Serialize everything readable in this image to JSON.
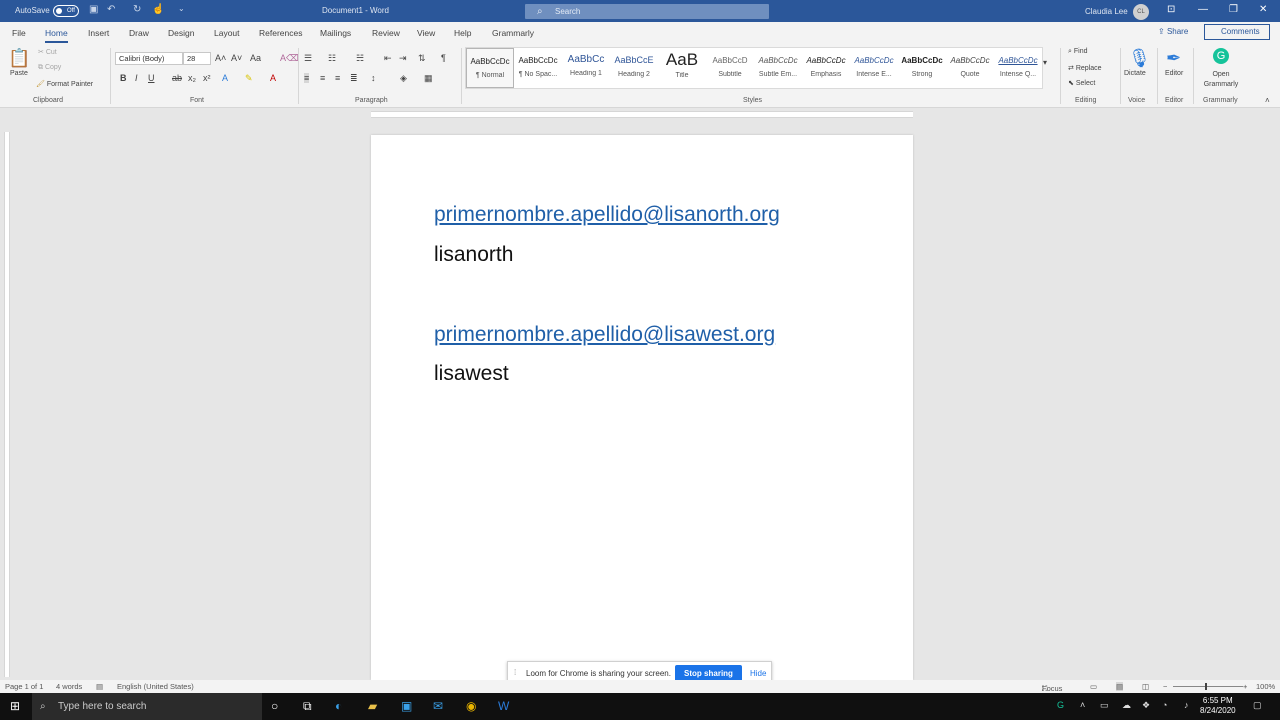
{
  "titlebar": {
    "autosave": "AutoSave",
    "autosave_state": "Off",
    "doc_title": "Document1 - Word",
    "search_placeholder": "Search",
    "user_name": "Claudia Lee",
    "user_initials": "CL"
  },
  "tabs": [
    "File",
    "Home",
    "Insert",
    "Draw",
    "Design",
    "Layout",
    "References",
    "Mailings",
    "Review",
    "View",
    "Help",
    "Grammarly"
  ],
  "share": "Share",
  "comments": "Comments",
  "clipboard": {
    "paste": "Paste",
    "cut": "Cut",
    "copy": "Copy",
    "format_painter": "Format Painter",
    "label": "Clipboard"
  },
  "font": {
    "name": "Calibri (Body)",
    "size": "28",
    "label": "Font"
  },
  "paragraph": {
    "label": "Paragraph"
  },
  "styles": {
    "label": "Styles",
    "items": [
      {
        "preview": "AaBbCcDc",
        "name": "¶ Normal"
      },
      {
        "preview": "AaBbCcDc",
        "name": "¶ No Spac..."
      },
      {
        "preview": "AaBbCc",
        "name": "Heading 1"
      },
      {
        "preview": "AaBbCcE",
        "name": "Heading 2"
      },
      {
        "preview": "AaB",
        "name": "Title"
      },
      {
        "preview": "AaBbCcD",
        "name": "Subtitle"
      },
      {
        "preview": "AaBbCcDc",
        "name": "Subtle Em..."
      },
      {
        "preview": "AaBbCcDc",
        "name": "Emphasis"
      },
      {
        "preview": "AaBbCcDc",
        "name": "Intense E..."
      },
      {
        "preview": "AaBbCcDc",
        "name": "Strong"
      },
      {
        "preview": "AaBbCcDc",
        "name": "Quote"
      },
      {
        "preview": "AaBbCcDc",
        "name": "Intense Q..."
      }
    ]
  },
  "editing": {
    "find": "Find",
    "replace": "Replace",
    "select": "Select",
    "label": "Editing"
  },
  "voice": {
    "dictate": "Dictate",
    "label": "Voice"
  },
  "editor": {
    "editor": "Editor",
    "label": "Editor"
  },
  "grammarly": {
    "open": "Open Grammarly",
    "label": "Grammarly"
  },
  "document": {
    "lines": [
      {
        "text": "primernombre.apellido@lisanorth.org",
        "link": true
      },
      {
        "text": "lisanorth",
        "link": false
      },
      {
        "text": "primernombre.apellido@lisawest.org",
        "link": true
      },
      {
        "text": "lisawest",
        "link": false
      }
    ]
  },
  "loom": {
    "message": "Loom for Chrome is sharing your screen.",
    "stop": "Stop sharing",
    "hide": "Hide"
  },
  "status": {
    "page": "Page 1 of 1",
    "words": "4 words",
    "language": "English (United States)",
    "focus": "Focus",
    "zoom": "100%"
  },
  "taskbar": {
    "search": "Type here to search",
    "time": "6:55 PM",
    "date": "8/24/2020"
  }
}
